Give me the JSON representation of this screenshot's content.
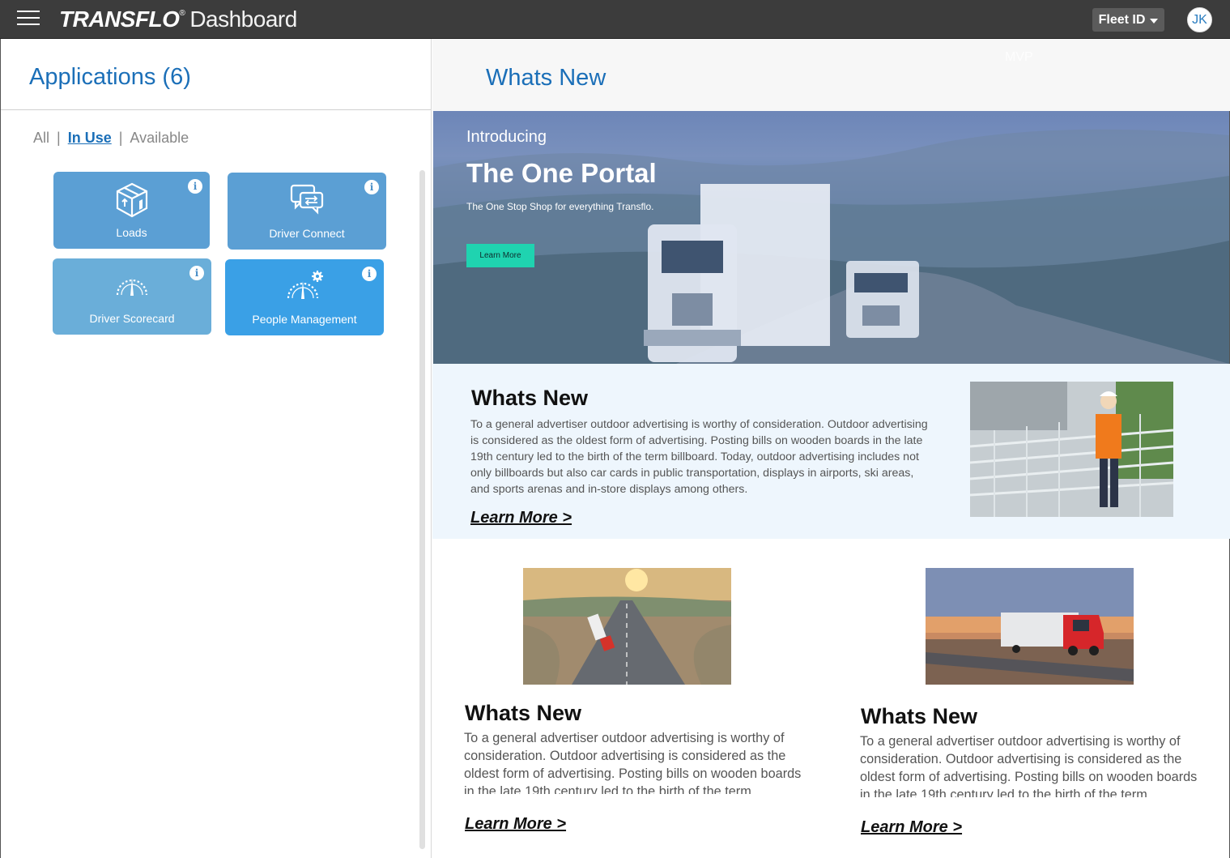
{
  "topbar": {
    "brand": "TRANSFLO",
    "brand_mark": "®",
    "app_name": "Dashboard",
    "fleet_label": "Fleet ID",
    "avatar_initials": "JK",
    "bg_color": "#3c3c3c"
  },
  "left": {
    "title": "Applications (6)",
    "filters": {
      "all": "All",
      "in_use": "In Use",
      "available": "Available",
      "separator": "|",
      "active": "In Use"
    },
    "tiles": [
      {
        "label": "Loads",
        "icon": "box-icon",
        "info": "i"
      },
      {
        "label": "Driver Connect",
        "icon": "chat-bubbles-icon",
        "info": "i"
      },
      {
        "label": "Driver Scorecard",
        "icon": "gauge-icon",
        "info": "i"
      },
      {
        "label": "People Management",
        "icon": "gauge-gear-icon",
        "info": "i"
      }
    ]
  },
  "right": {
    "title": "Whats New",
    "mvp": "MVP",
    "hero": {
      "intro": "Introducing",
      "title": "The One Portal",
      "subtitle": "The One Stop Shop for everything Transflo.",
      "button": "Learn More"
    },
    "feature": {
      "title": "Whats New",
      "text": "To a general advertiser outdoor advertising is worthy of consideration. Outdoor advertising is considered as the oldest form of advertising. Posting bills on wooden boards in the late 19th century led to the birth of the term billboard. Today, outdoor advertising includes not only billboards but also car cards in public transportation, displays in airports, ski areas, and sports arenas and in-store displays among others.",
      "link": "Learn More >"
    },
    "cards": [
      {
        "title": "Whats New",
        "text": "To a general advertiser outdoor advertising is worthy of consideration. Outdoor advertising is considered as the oldest form of advertising. Posting bills on wooden boards in the late 19th century led to the birth of the term billboard.",
        "link": "Learn More >"
      },
      {
        "title": "Whats New",
        "text": "To a general advertiser outdoor advertising is worthy of consideration. Outdoor advertising is considered as the oldest form of advertising. Posting bills on wooden boards in the late 19th century led to the birth of the term billboard. Today, outdoor advertising includes not only billboards.",
        "link": "Learn More >"
      }
    ]
  },
  "colors": {
    "accent_blue": "#1b6fb8",
    "tile_blue": "#5b9fd4",
    "tile_active": "#3aa0e6",
    "hero_button": "#1fd3b0",
    "feature_bg": "#eef6fd"
  }
}
